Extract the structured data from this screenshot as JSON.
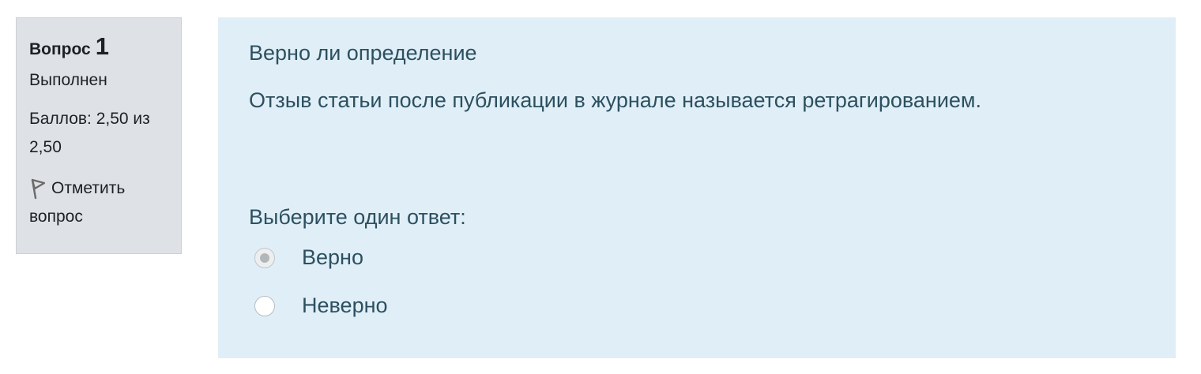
{
  "question_info": {
    "label": "Вопрос",
    "number": "1",
    "state": "Выполнен",
    "grade": "Баллов: 2,50 из 2,50",
    "flag_label": "Отметить вопрос",
    "flag_icon": "flag-icon"
  },
  "question": {
    "title": "Верно ли определение",
    "text": "Отзыв статьи после публикации в журнале называется ретрагированием.",
    "prompt": "Выберите один ответ:",
    "options": [
      {
        "label": "Верно",
        "selected": true
      },
      {
        "label": "Неверно",
        "selected": false
      }
    ]
  },
  "colors": {
    "info_panel_bg": "#dee2e6",
    "content_bg": "#e0eff7",
    "content_text": "#2d5060"
  }
}
